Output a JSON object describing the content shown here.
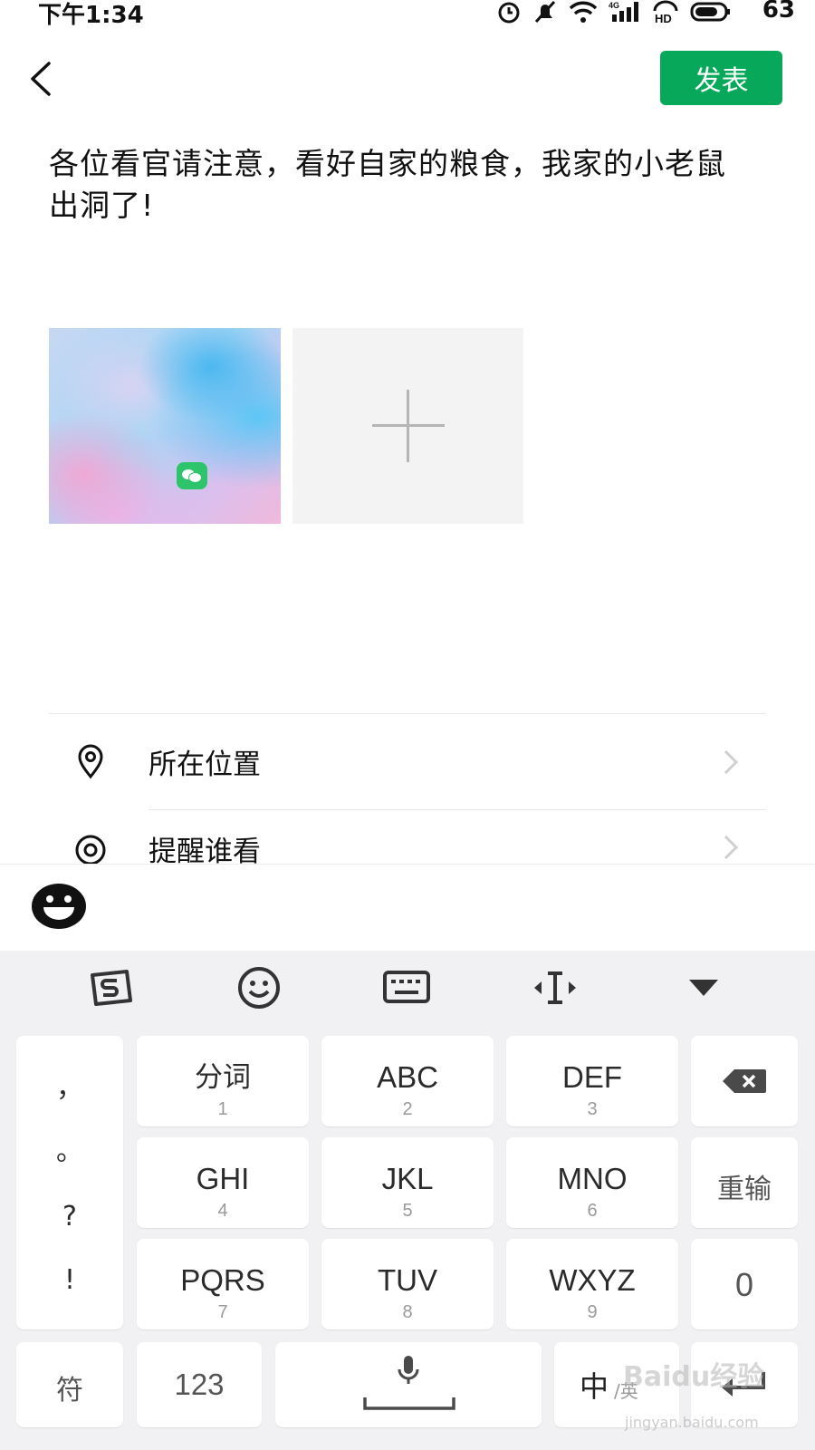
{
  "status_bar": {
    "time": "下午1:34",
    "network": "4G",
    "hd": "HD",
    "battery": "63"
  },
  "header": {
    "back_icon": "chevron-left-icon",
    "publish_label": "发表",
    "accent_color": "#07a85a"
  },
  "post": {
    "text": "各位看官请注意，看好自家的粮食，我家的小老鼠出洞了!"
  },
  "media": {
    "add_icon": "plus-icon"
  },
  "options": [
    {
      "icon": "location-pin-icon",
      "label": "所在位置"
    },
    {
      "icon": "at-sign-icon",
      "label": "提醒谁看"
    }
  ],
  "emoji_bar": {
    "icon": "emoji-face-icon"
  },
  "keyboard": {
    "toolbar": [
      "sogou-logo-icon",
      "smiley-icon",
      "keyboard-icon",
      "cursor-move-icon",
      "collapse-triangle-icon"
    ],
    "punctuation": [
      "，",
      "。",
      "?",
      "!"
    ],
    "keys": [
      {
        "main": "分词",
        "sub": "1"
      },
      {
        "main": "ABC",
        "sub": "2"
      },
      {
        "main": "DEF",
        "sub": "3"
      },
      {
        "main": "GHI",
        "sub": "4"
      },
      {
        "main": "JKL",
        "sub": "5"
      },
      {
        "main": "MNO",
        "sub": "6"
      },
      {
        "main": "PQRS",
        "sub": "7"
      },
      {
        "main": "TUV",
        "sub": "8"
      },
      {
        "main": "WXYZ",
        "sub": "9"
      }
    ],
    "reenter_label": "重输",
    "zero_label": "0",
    "symbol_label": "符",
    "num_label": "123",
    "lang_main": "中",
    "lang_sub": "/英"
  },
  "watermark": {
    "text": "Baidu经验",
    "url": "jingyan.baidu.com"
  }
}
